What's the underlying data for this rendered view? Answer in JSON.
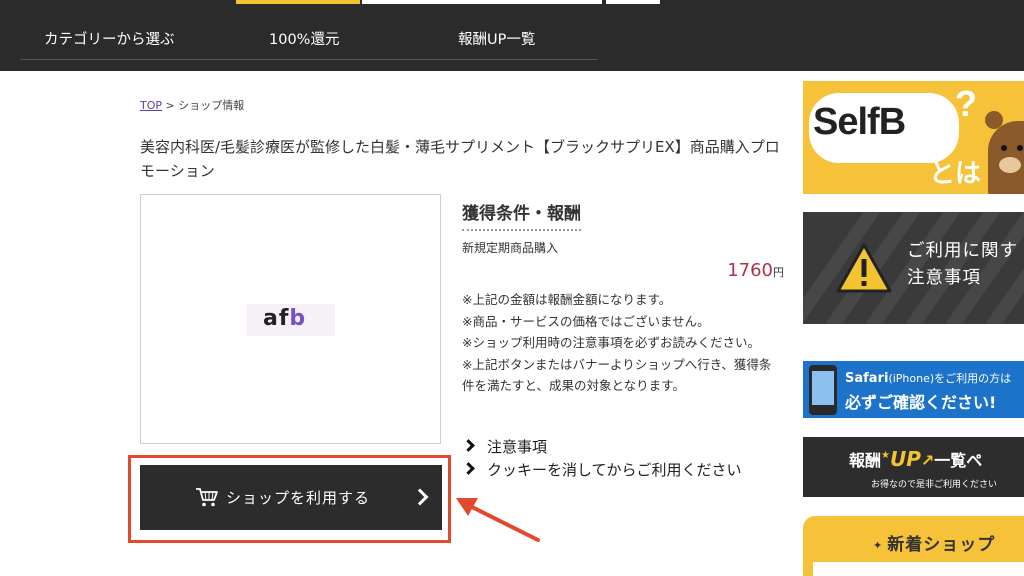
{
  "header": {
    "nav": [
      "カテゴリーから選ぶ",
      "100%還元",
      "報酬UP一覧"
    ]
  },
  "breadcrumb": {
    "home": "TOP",
    "separator": ">",
    "current": "ショップ情報"
  },
  "product": {
    "title": "美容内科医/毛髪診療医が監修した白髪・薄毛サプリメント【ブラックサプリEX】商品購入プロモーション",
    "logo_text_a": "af",
    "logo_text_b": "b"
  },
  "conditions": {
    "heading": "獲得条件・報酬",
    "condition": "新規定期商品購入",
    "price": "1760",
    "price_unit": "円",
    "notes": [
      "※上記の金額は報酬金額になります。",
      "※商品・サービスの価格ではございません。",
      "※ショップ利用時の注意事項を必ずお読みください。",
      "※上記ボタンまたはバナーよりショップへ行き、獲得条件を満たすと、成果の対象となります。"
    ],
    "links": [
      "注意事項",
      "クッキーを消してからご利用ください"
    ]
  },
  "shop_button": {
    "label": "ショップを利用する"
  },
  "sidebar": {
    "selfb": {
      "logo": "SelfB",
      "question": "?",
      "toha": "とは"
    },
    "caution": {
      "line1": "ご利用に関す",
      "line2": "注意事項"
    },
    "safari": {
      "line1_brand": "Safari",
      "line1_device": "(iPhone)",
      "line1_rest": "をご利用の方は",
      "line2": "必ずご確認ください!"
    },
    "up": {
      "prefix": "報酬",
      "star": "★",
      "up": "UP",
      "suffix": "一覧ペ",
      "sub": "お得なので是非ご利用ください"
    },
    "new_shops": {
      "title": "新着ショップ"
    }
  },
  "colors": {
    "header_bg": "#2b2b2b",
    "accent_yellow": "#f3c431",
    "price_red": "#b0324a",
    "highlight_red": "#e14a2c",
    "safari_blue": "#1d73c9"
  },
  "icons": [
    "cart-icon",
    "chevron-right-icon",
    "warning-icon",
    "phone-icon",
    "arrow-icon"
  ]
}
